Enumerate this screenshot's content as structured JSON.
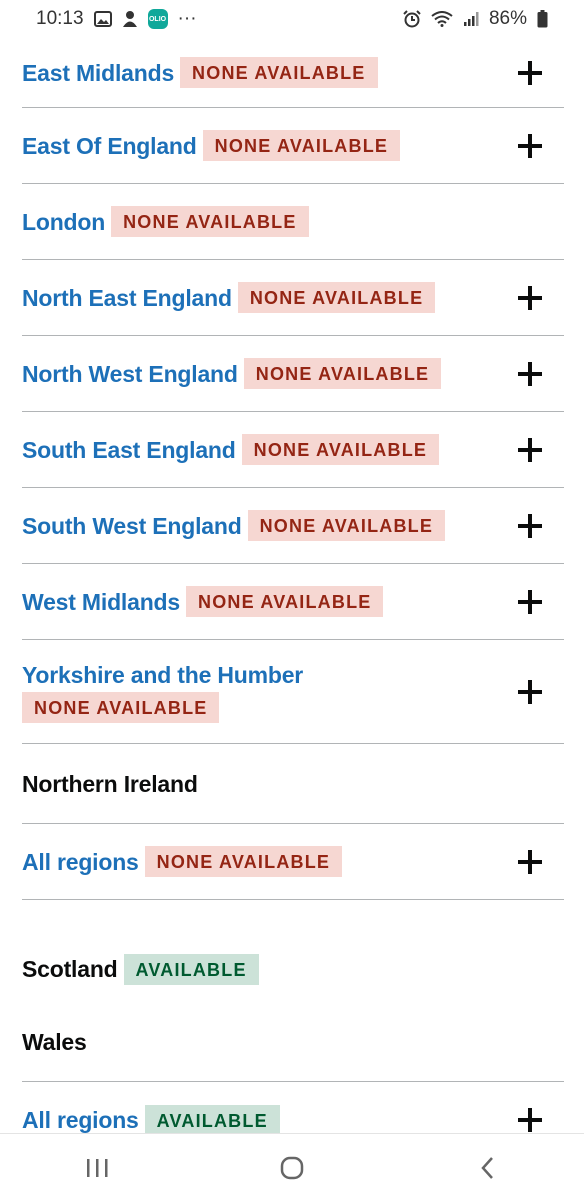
{
  "status_bar": {
    "time": "10:13",
    "dots": "···",
    "battery": "86%",
    "app_badge": "OLIO",
    "icons": [
      "gallery-icon",
      "guard-icon",
      "alarm-icon",
      "wifi-icon",
      "signal-icon",
      "battery-icon"
    ]
  },
  "rows": [
    {
      "region": "East Midlands",
      "status": "NONE AVAILABLE",
      "expandable": true
    },
    {
      "region": "East Of England",
      "status": "NONE AVAILABLE",
      "expandable": true
    },
    {
      "region": "London",
      "status": "NONE AVAILABLE",
      "expandable": false
    },
    {
      "region": "North East England",
      "status": "NONE AVAILABLE",
      "expandable": true
    },
    {
      "region": "North West England",
      "status": "NONE AVAILABLE",
      "expandable": true
    },
    {
      "region": "South East England",
      "status": "NONE AVAILABLE",
      "expandable": true
    },
    {
      "region": "South West England",
      "status": "NONE AVAILABLE",
      "expandable": true
    },
    {
      "region": "West Midlands",
      "status": "NONE AVAILABLE",
      "expandable": true
    },
    {
      "region": "Yorkshire and the Humber",
      "status": "NONE AVAILABLE",
      "expandable": true
    },
    {
      "region": "Northern Ireland"
    },
    {
      "region": "All regions",
      "status": "NONE AVAILABLE",
      "expandable": true
    },
    {
      "region": "Scotland",
      "status": "AVAILABLE"
    },
    {
      "region": "Wales"
    },
    {
      "region": "All regions",
      "status": "AVAILABLE",
      "expandable": true
    }
  ],
  "colors": {
    "link": "#1d70b8",
    "none_bg": "#f6d7d2",
    "none_text": "#942514",
    "available_bg": "#cce2d8",
    "available_text": "#005a30"
  },
  "nav_bar": {
    "icons": [
      "recent-apps-icon",
      "home-icon",
      "back-icon"
    ]
  }
}
